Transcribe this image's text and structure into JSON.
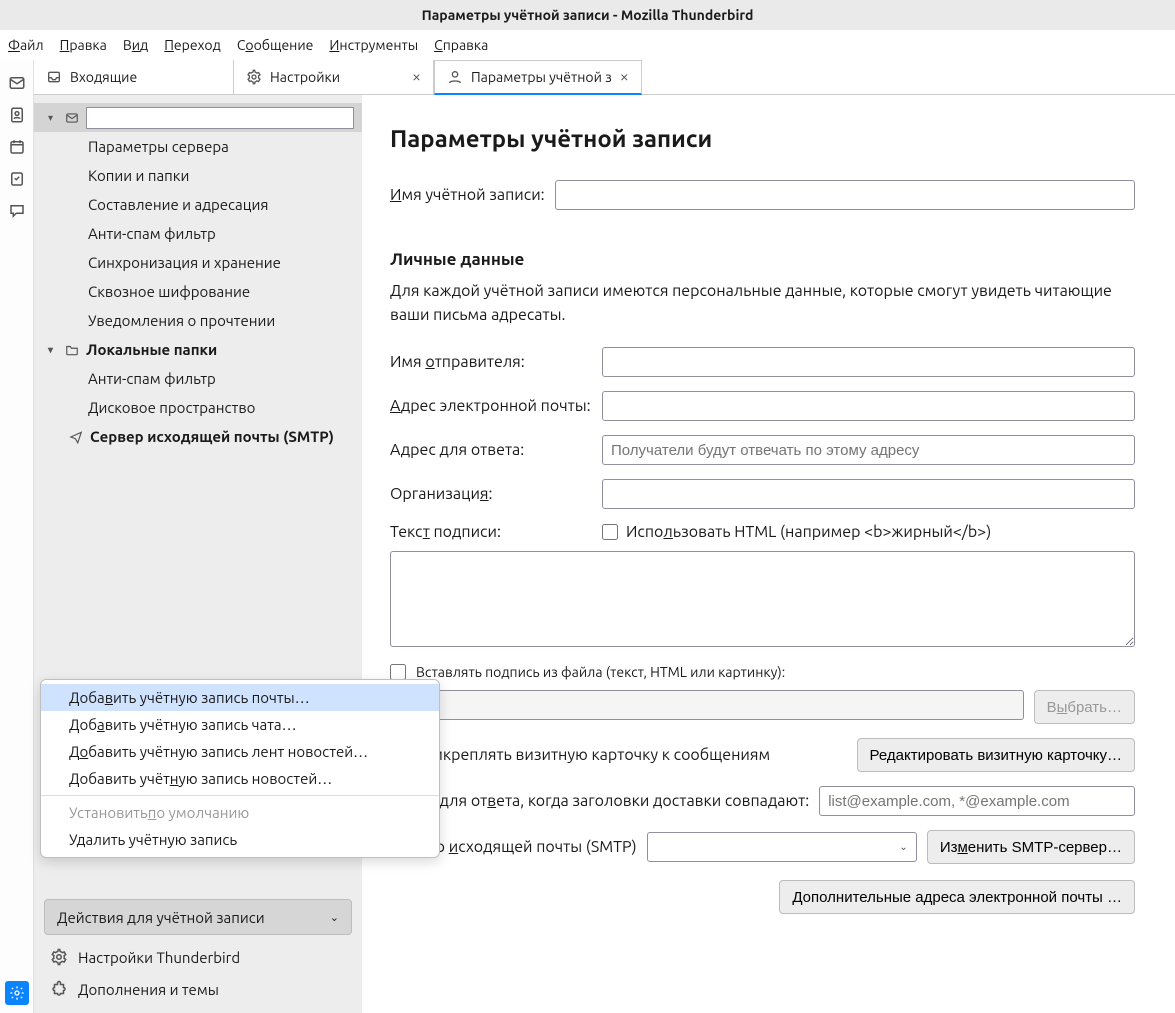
{
  "window": {
    "title": "Параметры учётной записи - Mozilla Thunderbird"
  },
  "menubar": [
    "Файл",
    "Правка",
    "Вид",
    "Переход",
    "Сообщение",
    "Инструменты",
    "Справка"
  ],
  "tabs": {
    "inbox": "Входящие",
    "settings": "Настройки",
    "params": "Параметры учётной з"
  },
  "tree": {
    "account1": {
      "name": ""
    },
    "items1": [
      "Параметры сервера",
      "Копии и папки",
      "Составление и адресация",
      "Анти-спам фильтр",
      "Синхронизация и хранение",
      "Сквозное шифрование",
      "Уведомления о прочтении"
    ],
    "local": "Локальные папки",
    "items2": [
      "Анти-спам фильтр",
      "Дисковое пространство"
    ],
    "smtp": "Сервер исходящей почты (SMTP)"
  },
  "actions_button": "Действия для учётной записи",
  "sb_settings": "Настройки Thunderbird",
  "sb_addons": "Дополнения и темы",
  "popup": {
    "i0": "Добавить учётную запись почты…",
    "i1": "Добавить учётную запись чата…",
    "i2": "Добавить учётную запись лент новостей…",
    "i3": "Добавить учётную запись новостей…",
    "i4": "Установить по умолчанию",
    "i5": "Удалить учётную запись"
  },
  "main": {
    "title": "Параметры учётной записи",
    "account_name_label": "Имя учётной записи:",
    "account_name_value": "",
    "section": "Личные данные",
    "desc": "Для каждой учётной записи имеются персональные данные, которые смогут увидеть читающие ваши письма адресаты.",
    "sender_label": "Имя отправителя:",
    "sender_value": "",
    "email_label": "Адрес электронной почты:",
    "email_value": "",
    "reply_label": "Адрес для ответа:",
    "reply_placeholder": "Получатели будут отвечать по этому адресу",
    "org_label": "Организация:",
    "org_value": "",
    "sig_label": "Текст подписи:",
    "html_check": "Использовать HTML (например <b>жирный</b>)",
    "file_check": "Вставлять подпись из файла (текст, HTML или картинку):",
    "browse": "Выбрать…",
    "vcard_check": "Прикреплять визитную карточку к сообщениям",
    "vcard_edit": "Редактировать визитную карточку…",
    "replyto_label": "Адрес для ответа, когда заголовки доставки совпадают:",
    "replyto_placeholder": "list@example.com, *@example.com",
    "smtp_label": "Сервер исходящей почты (SMTP)",
    "smtp_edit": "Изменить SMTP-сервер…",
    "extra": "Дополнительные адреса электронной почты …"
  }
}
